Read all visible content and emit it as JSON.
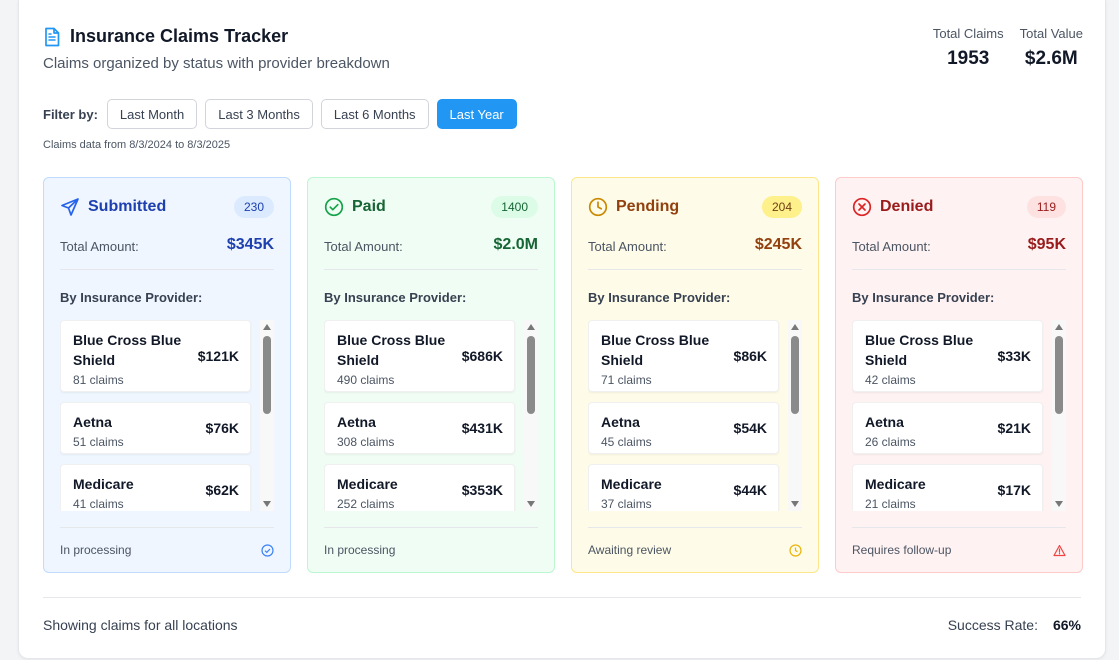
{
  "header": {
    "title": "Insurance Claims Tracker",
    "subtitle": "Claims organized by status with provider breakdown",
    "totals": [
      {
        "label": "Total Claims",
        "value": "1953"
      },
      {
        "label": "Total Value",
        "value": "$2.6M"
      }
    ]
  },
  "filters": {
    "label": "Filter by:",
    "options": [
      "Last Month",
      "Last 3 Months",
      "Last 6 Months",
      "Last Year"
    ],
    "active": "Last Year",
    "range_note": "Claims data from 8/3/2024 to 8/3/2025"
  },
  "colors": {
    "accent": "#2196f3",
    "submitted": "#1e40af",
    "paid": "#166534",
    "pending": "#92400e",
    "denied": "#991b1b"
  },
  "columns": [
    {
      "name": "Submitted",
      "icon": "send-icon",
      "count": "230",
      "total_label": "Total Amount:",
      "total": "$345K",
      "provider_title": "By Insurance Provider:",
      "providers": [
        {
          "name": "Blue Cross Blue Shield",
          "claims": "81 claims",
          "amount": "$121K"
        },
        {
          "name": "Aetna",
          "claims": "51 claims",
          "amount": "$76K"
        },
        {
          "name": "Medicare",
          "claims": "41 claims",
          "amount": "$62K"
        }
      ],
      "footer": "In processing",
      "footer_icon": "clock-check-icon"
    },
    {
      "name": "Paid",
      "icon": "check-circle-icon",
      "count": "1400",
      "total_label": "Total Amount:",
      "total": "$2.0M",
      "provider_title": "By Insurance Provider:",
      "providers": [
        {
          "name": "Blue Cross Blue Shield",
          "claims": "490 claims",
          "amount": "$686K"
        },
        {
          "name": "Aetna",
          "claims": "308 claims",
          "amount": "$431K"
        },
        {
          "name": "Medicare",
          "claims": "252 claims",
          "amount": "$353K"
        }
      ],
      "footer": "In processing",
      "footer_icon": ""
    },
    {
      "name": "Pending",
      "icon": "clock-icon",
      "count": "204",
      "total_label": "Total Amount:",
      "total": "$245K",
      "provider_title": "By Insurance Provider:",
      "providers": [
        {
          "name": "Blue Cross Blue Shield",
          "claims": "71 claims",
          "amount": "$86K"
        },
        {
          "name": "Aetna",
          "claims": "45 claims",
          "amount": "$54K"
        },
        {
          "name": "Medicare",
          "claims": "37 claims",
          "amount": "$44K"
        }
      ],
      "footer": "Awaiting review",
      "footer_icon": "clock-icon"
    },
    {
      "name": "Denied",
      "icon": "x-circle-icon",
      "count": "119",
      "total_label": "Total Amount:",
      "total": "$95K",
      "provider_title": "By Insurance Provider:",
      "providers": [
        {
          "name": "Blue Cross Blue Shield",
          "claims": "42 claims",
          "amount": "$33K"
        },
        {
          "name": "Aetna",
          "claims": "26 claims",
          "amount": "$21K"
        },
        {
          "name": "Medicare",
          "claims": "21 claims",
          "amount": "$17K"
        }
      ],
      "footer": "Requires follow-up",
      "footer_icon": "alert-triangle-icon"
    }
  ],
  "footer": {
    "location_text": "Showing claims for all locations",
    "success_label": "Success Rate:",
    "success_value": "66%"
  }
}
